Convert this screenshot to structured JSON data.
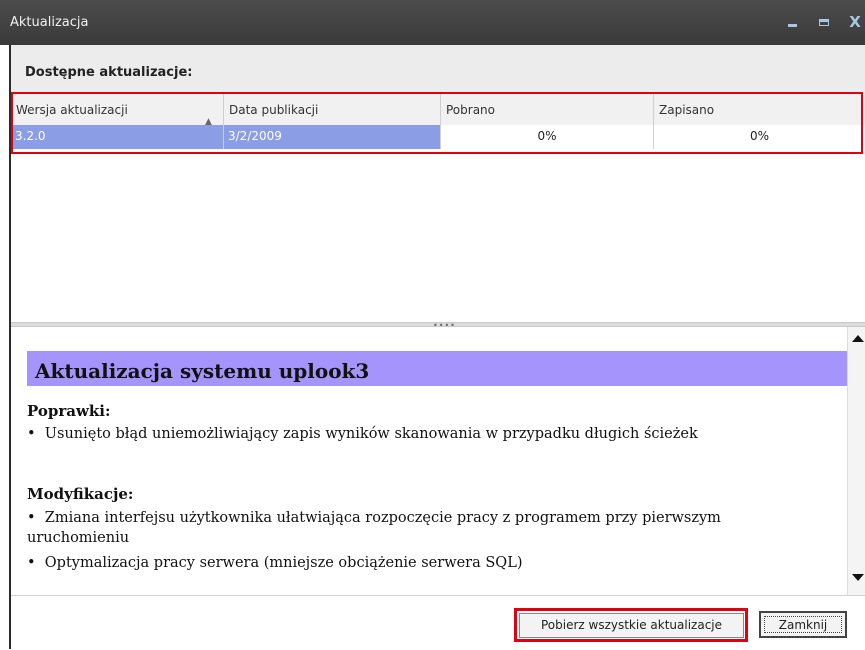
{
  "window": {
    "title": "Aktualizacja",
    "minimize_icon": "minimize-icon",
    "maximize_icon": "maximize-icon",
    "close_glyph": "X"
  },
  "section": {
    "label": "Dostępne aktualizacje:"
  },
  "grid": {
    "columns": [
      "Wersja aktualizacji",
      "Data publikacji",
      "Pobrano",
      "Zapisano"
    ],
    "sort_icon": "sort-ascending-icon",
    "sort_glyph": "▲",
    "rows": [
      {
        "version": "3.2.0",
        "date": "3/2/2009",
        "downloaded": "0%",
        "saved": "0%"
      }
    ]
  },
  "splitter": {
    "grip": "••••"
  },
  "notes": {
    "title": "Aktualizacja systemu uplook3",
    "sections": [
      {
        "heading": "Poprawki:",
        "items": [
          "Usunięto błąd uniemożliwiający zapis wyników skanowania w przypadku długich ścieżek"
        ]
      },
      {
        "heading": "Modyfikacje:",
        "items": [
          "Zmiana interfejsu użytkownika ułatwiająca rozpoczęcie pracy z programem przy pierwszym uruchomieniu",
          "Optymalizacja pracy serwera (mniejsze obciążenie serwera SQL)"
        ]
      }
    ]
  },
  "footer": {
    "download_all_label": "Pobierz wszystkie aktualizacje",
    "close_label": "Zamknij"
  },
  "colors": {
    "titlebar": "#3f3f3f",
    "selected_row": "#8b9de4",
    "heading_bar": "#a494fb",
    "highlight": "#e00010"
  }
}
